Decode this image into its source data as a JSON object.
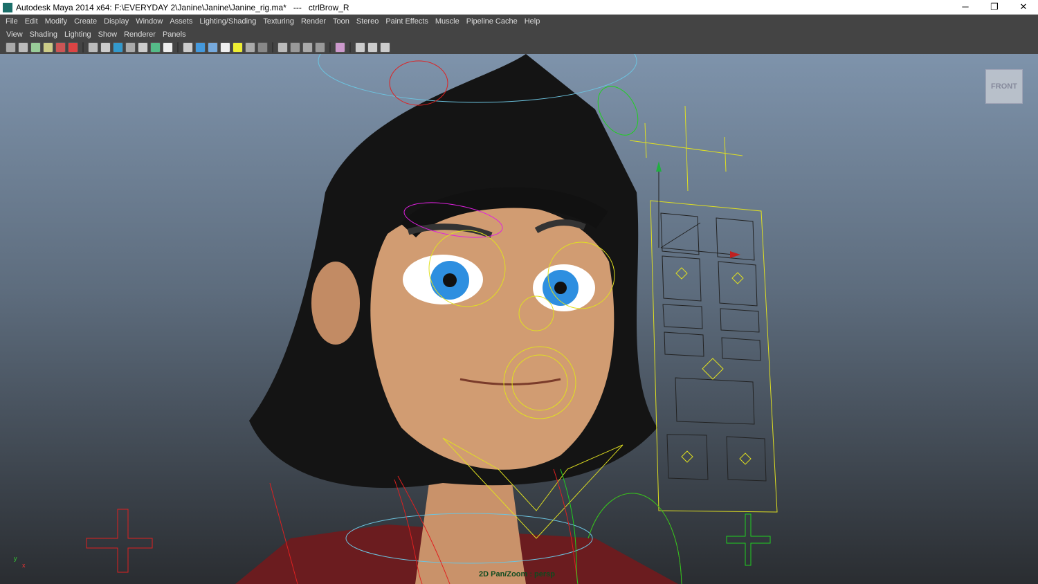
{
  "window": {
    "title": "Autodesk Maya 2014 x64: F:\\EVERYDAY 2\\Janine\\Janine\\Janine_rig.ma*   ---   ctrlBrow_R",
    "minimize": "─",
    "restore": "❐",
    "close": "✕"
  },
  "menu": [
    "File",
    "Edit",
    "Modify",
    "Create",
    "Display",
    "Window",
    "Assets",
    "Lighting/Shading",
    "Texturing",
    "Render",
    "Toon",
    "Stereo",
    "Paint Effects",
    "Muscle",
    "Pipeline Cache",
    "Help"
  ],
  "panel_menu": [
    "View",
    "Shading",
    "Lighting",
    "Show",
    "Renderer",
    "Panels"
  ],
  "toolbar_icons": [
    "select-camera-icon",
    "lock-camera-icon",
    "camera-attributes-icon",
    "bookmark-icon",
    "image-plane-icon",
    "grease-pencil-icon",
    "sep",
    "grid-icon",
    "film-gate-icon",
    "resolution-gate-icon",
    "gate-mask-icon",
    "field-chart-icon",
    "safe-action-icon",
    "safe-title-icon",
    "sep",
    "wireframe-icon",
    "smooth-shade-icon",
    "wireframe-on-shaded-icon",
    "textured-icon",
    "use-all-lights-icon",
    "shadows-icon",
    "ambient-occlusion-icon",
    "sep",
    "xray-icon",
    "xray-joints-icon",
    "xray-components-icon",
    "isolate-icon",
    "sep",
    "isolate-select-icon",
    "sep",
    "default-view-icon",
    "two-sided-lighting-icon",
    "motion-blur-icon"
  ],
  "viewport": {
    "hud": "2D Pan/Zoom : persp",
    "view_cube": "FRONT",
    "axis_y": "y",
    "axis_x": "x"
  }
}
